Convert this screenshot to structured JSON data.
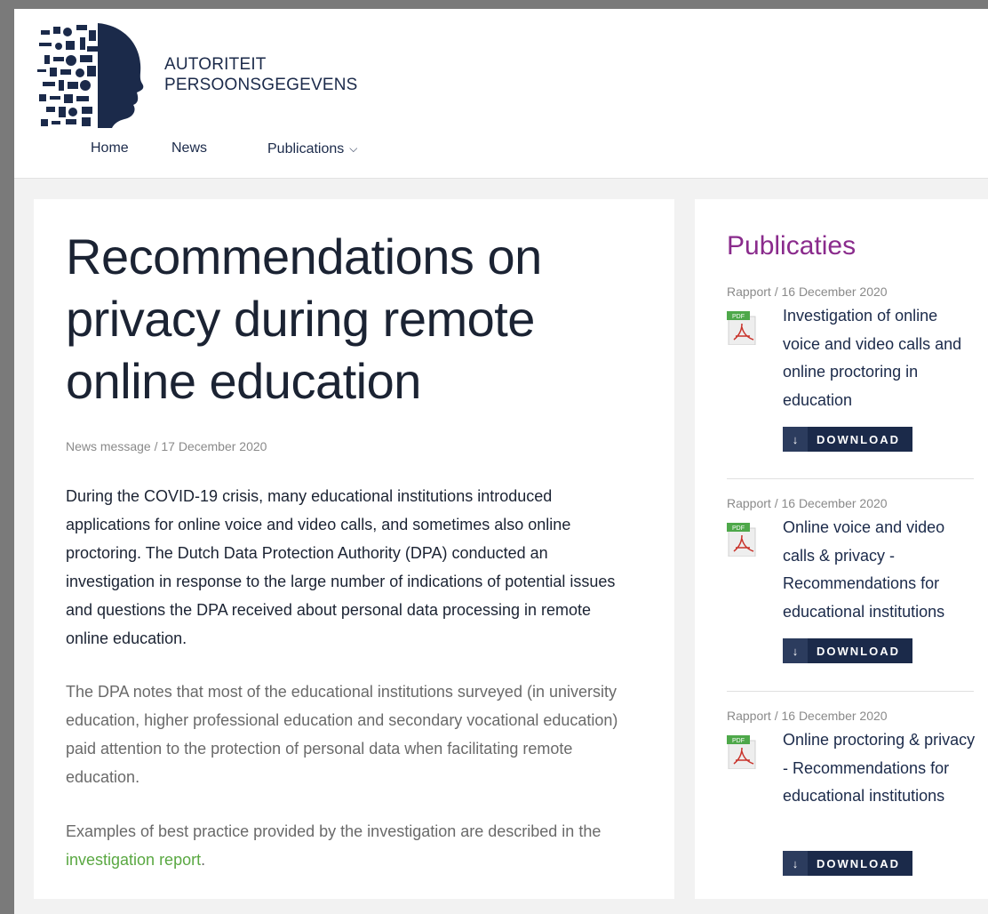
{
  "brand": {
    "line1": "AUTORITEIT",
    "line2": "PERSOONSGEGEVENS",
    "logo_icon": "profile-head-collage-icon"
  },
  "nav": {
    "home": "Home",
    "news": "News",
    "publications": "Publications",
    "publications_chevron": "⌵"
  },
  "article": {
    "title": "Recommendations on privacy during remote online education",
    "meta": "News message / 17 December 2020",
    "lead": "During the COVID-19 crisis, many educational institutions introduced applications for online voice and video calls, and sometimes also online proctoring. The Dutch Data Protection Authority (DPA) conducted an investigation in response to the large number of indications of potential issues and questions the DPA received about personal data processing in remote online education.",
    "para1": "The DPA notes that most of the educational institutions surveyed (in university education, higher professional education and secondary vocational education) paid attention to the protection of personal data when facilitating remote education.",
    "para2_prefix": "Examples of best practice provided by the investigation are described in the ",
    "para2_link": "investigation report",
    "para2_suffix": "."
  },
  "sidebar": {
    "title": "Publicaties",
    "publications": [
      {
        "meta": "Rapport / 16 December 2020",
        "title": "Investigation of online voice and video calls and online proctoring in education",
        "download_label": "DOWNLOAD"
      },
      {
        "meta": "Rapport / 16 December 2020",
        "title": "Online voice and video calls & privacy - Recommendations for educational institutions",
        "download_label": "DOWNLOAD"
      },
      {
        "meta": "Rapport / 16 December 2020",
        "title": "Online proctoring & privacy - Recommendations for educational institutions",
        "download_label": "DOWNLOAD"
      }
    ],
    "pdf_icon_label": "PDF",
    "download_arrow": "↓"
  },
  "colors": {
    "navy": "#1b2a4a",
    "purple": "#8a2b8c",
    "link_green": "#5aa842",
    "pdf_green": "#4ea84a"
  }
}
